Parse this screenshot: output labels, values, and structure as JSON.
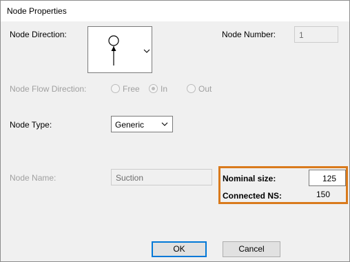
{
  "window": {
    "title": "Node Properties"
  },
  "node_direction": {
    "label": "Node Direction:",
    "icon": "node-direction-up-arrow-icon"
  },
  "node_number": {
    "label": "Node Number:",
    "value": "1"
  },
  "node_flow_direction": {
    "label": "Node Flow Direction:",
    "options": [
      {
        "label": "Free",
        "selected": false
      },
      {
        "label": "In",
        "selected": true
      },
      {
        "label": "Out",
        "selected": false
      }
    ]
  },
  "node_type": {
    "label": "Node Type:",
    "selected": "Generic"
  },
  "node_name": {
    "label": "Node Name:",
    "value": "Suction"
  },
  "nominal_size": {
    "label": "Nominal size:",
    "value": "125"
  },
  "connected_ns": {
    "label": "Connected NS:",
    "value": "150"
  },
  "buttons": {
    "ok": "OK",
    "cancel": "Cancel"
  },
  "colors": {
    "highlight": "#d97a1c",
    "default_button_border": "#0078d7"
  }
}
